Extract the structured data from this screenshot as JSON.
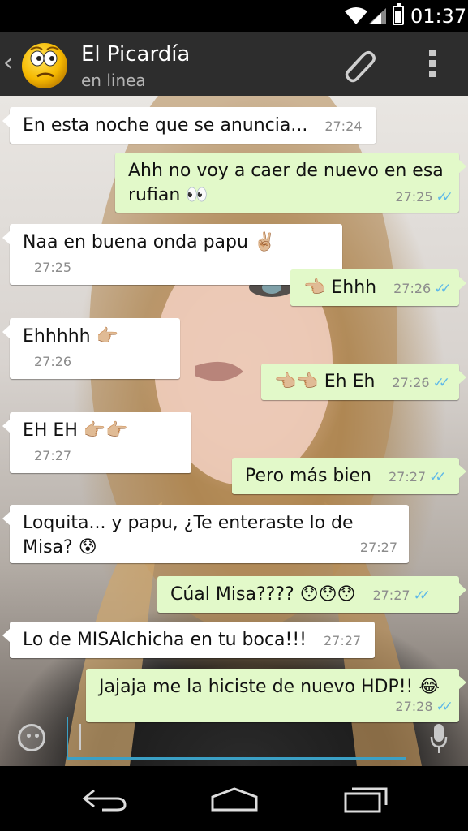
{
  "status_bar": {
    "time": "01:37"
  },
  "header": {
    "back_glyph": "‹",
    "contact_name": "El Picardía",
    "contact_status": "en linea",
    "attach_icon": "paperclip-icon",
    "menu_icon": "overflow-menu-icon"
  },
  "messages": [
    {
      "dir": "in",
      "text": "En esta noche que se anuncia...",
      "time": "27:24"
    },
    {
      "dir": "out",
      "text": "Ahh no voy a caer de nuevo en esa\nrufian 👀",
      "time": "27:25",
      "read": true
    },
    {
      "dir": "in",
      "text": "Naa en buena onda papu ✌🏼",
      "time": "27:25"
    },
    {
      "dir": "out",
      "text": "👈🏼 Ehhh",
      "time": "27:26",
      "read": true
    },
    {
      "dir": "in",
      "text": "Ehhhhh 👉🏼",
      "time": "27:26"
    },
    {
      "dir": "out",
      "text": "👈🏼👈🏼 Eh Eh",
      "time": "27:26",
      "read": true
    },
    {
      "dir": "in",
      "text": "EH EH 👉🏼👉🏼",
      "time": "27:27"
    },
    {
      "dir": "out",
      "text": "Pero más bien",
      "time": "27:27",
      "read": true
    },
    {
      "dir": "in",
      "text": "Loquita... y papu, ¿Te enteraste lo de\nMisa? 😰",
      "time": "27:27"
    },
    {
      "dir": "out",
      "text": "Cúal Misa???? 😯😯😯",
      "time": "27:27",
      "read": true
    },
    {
      "dir": "in",
      "text": "Lo de MISAlchicha en tu boca!!!",
      "time": "27:27"
    },
    {
      "dir": "out",
      "text": "Jajaja me la hiciste de nuevo HDP!! 😂",
      "time": "27:28",
      "read": true
    }
  ],
  "composer": {
    "emoji_icon": "smiley-icon",
    "mic_icon": "microphone-icon"
  },
  "nav": {
    "back": "back-icon",
    "home": "home-icon",
    "recents": "recents-icon"
  },
  "colors": {
    "incoming": "#ffffff",
    "outgoing": "#e2f9c9",
    "read_ticks": "#5fb9e8",
    "header": "#2d2d2d",
    "input_accent": "#3ba0c5"
  }
}
